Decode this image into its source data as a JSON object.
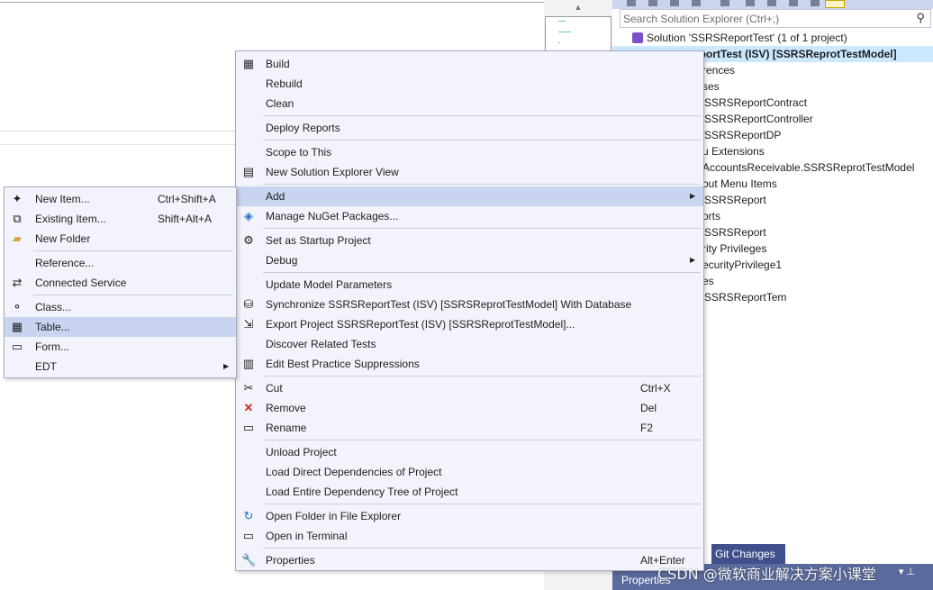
{
  "solution_explorer": {
    "search_placeholder": "Search Solution Explorer (Ctrl+;)",
    "root": "Solution 'SSRSReportTest' (1 of 1 project)",
    "project": "eportTest (ISV) [SSRSReprotTestModel]",
    "items": [
      "rences",
      "ses",
      "SSRSReportContract",
      "SSRSReportController",
      "SSRSReportDP",
      "u Extensions",
      "AccountsReceivable.SSRSReprotTestModel",
      "out Menu Items",
      "SSRSReport",
      "orts",
      "SSRSReport",
      "rity Privileges",
      "ecurityPrivilege1",
      "es",
      "SSRSReportTem"
    ],
    "git_changes": "Git Changes",
    "properties": "Properties"
  },
  "context_menu": {
    "items": [
      {
        "label": "Build",
        "icon": "build-icon"
      },
      {
        "label": "Rebuild"
      },
      {
        "label": "Clean"
      },
      {
        "label": "Deploy Reports"
      },
      {
        "label": "Scope to This"
      },
      {
        "label": "New Solution Explorer View",
        "icon": "new-view-icon"
      },
      {
        "label": "Add",
        "submenu": true
      },
      {
        "label": "Manage NuGet Packages...",
        "icon": "nuget-icon"
      },
      {
        "label": "Set as Startup Project",
        "icon": "gear-icon"
      },
      {
        "label": "Debug",
        "submenu": true
      },
      {
        "label": "Update Model Parameters"
      },
      {
        "label": "Synchronize SSRSReportTest (ISV) [SSRSReprotTestModel] With Database",
        "icon": "sync-db-icon"
      },
      {
        "label": "Export Project SSRSReportTest (ISV) [SSRSReprotTestModel]...",
        "icon": "export-icon"
      },
      {
        "label": "Discover Related Tests"
      },
      {
        "label": "Edit Best Practice Suppressions",
        "icon": "suppressions-icon"
      },
      {
        "label": "Cut",
        "shortcut": "Ctrl+X",
        "icon": "scissors-icon"
      },
      {
        "label": "Remove",
        "shortcut": "Del",
        "icon": "remove-x-icon"
      },
      {
        "label": "Rename",
        "shortcut": "F2",
        "icon": "rename-icon"
      },
      {
        "label": "Unload Project"
      },
      {
        "label": "Load Direct Dependencies of Project"
      },
      {
        "label": "Load Entire Dependency Tree of Project"
      },
      {
        "label": "Open Folder in File Explorer",
        "icon": "open-folder-icon"
      },
      {
        "label": "Open in Terminal",
        "icon": "terminal-icon"
      },
      {
        "label": "Properties",
        "shortcut": "Alt+Enter",
        "icon": "wrench-icon"
      }
    ]
  },
  "add_submenu": {
    "items": [
      {
        "label": "New Item...",
        "shortcut": "Ctrl+Shift+A",
        "icon": "new-item-icon"
      },
      {
        "label": "Existing Item...",
        "shortcut": "Shift+Alt+A",
        "icon": "existing-item-icon"
      },
      {
        "label": "New Folder",
        "icon": "folder-icon"
      },
      {
        "label": "Reference..."
      },
      {
        "label": "Connected Service",
        "icon": "connected-service-icon"
      },
      {
        "label": "Class...",
        "icon": "class-icon"
      },
      {
        "label": "Table...",
        "icon": "table-icon"
      },
      {
        "label": "Form...",
        "icon": "form-icon"
      },
      {
        "label": "EDT",
        "submenu": true
      }
    ]
  },
  "watermark": "CSDN @微软商业解决方案小课堂"
}
